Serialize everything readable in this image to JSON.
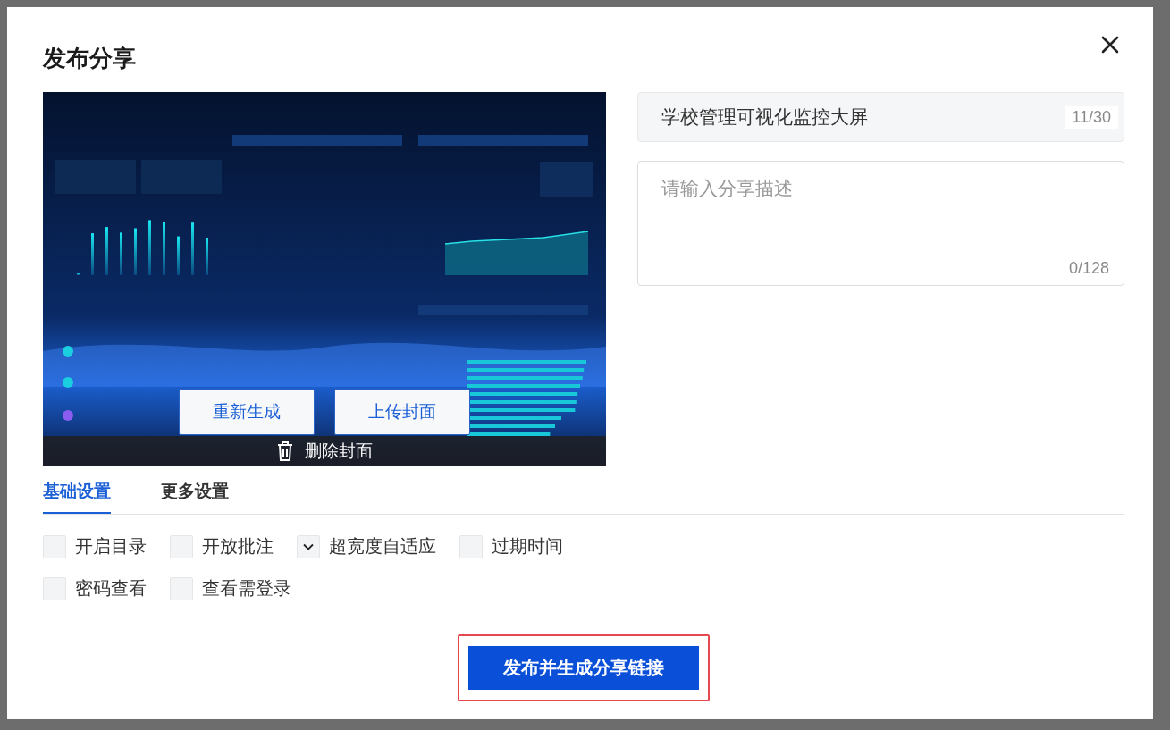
{
  "dialog": {
    "title": "发布分享"
  },
  "cover": {
    "actions": [
      {
        "label": "重新生成"
      },
      {
        "label": "上传封面"
      }
    ],
    "delete_label": "删除封面"
  },
  "title_field": {
    "value": "学校管理可视化监控大屏",
    "count": "11/30"
  },
  "description_field": {
    "placeholder": "请输入分享描述",
    "count": "0/128"
  },
  "tabs": [
    {
      "label": "基础设置",
      "selected": true
    },
    {
      "label": "更多设置",
      "selected": false
    }
  ],
  "options": [
    {
      "label": "开启目录",
      "checked": false
    },
    {
      "label": "开放批注",
      "checked": false
    },
    {
      "label": "超宽度自适应",
      "checked": true
    },
    {
      "label": "过期时间",
      "checked": false
    },
    {
      "label": "密码查看",
      "checked": false
    },
    {
      "label": "查看需登录",
      "checked": false
    }
  ],
  "publish_button": {
    "label": "发布并生成分享链接",
    "highlighted": true
  }
}
